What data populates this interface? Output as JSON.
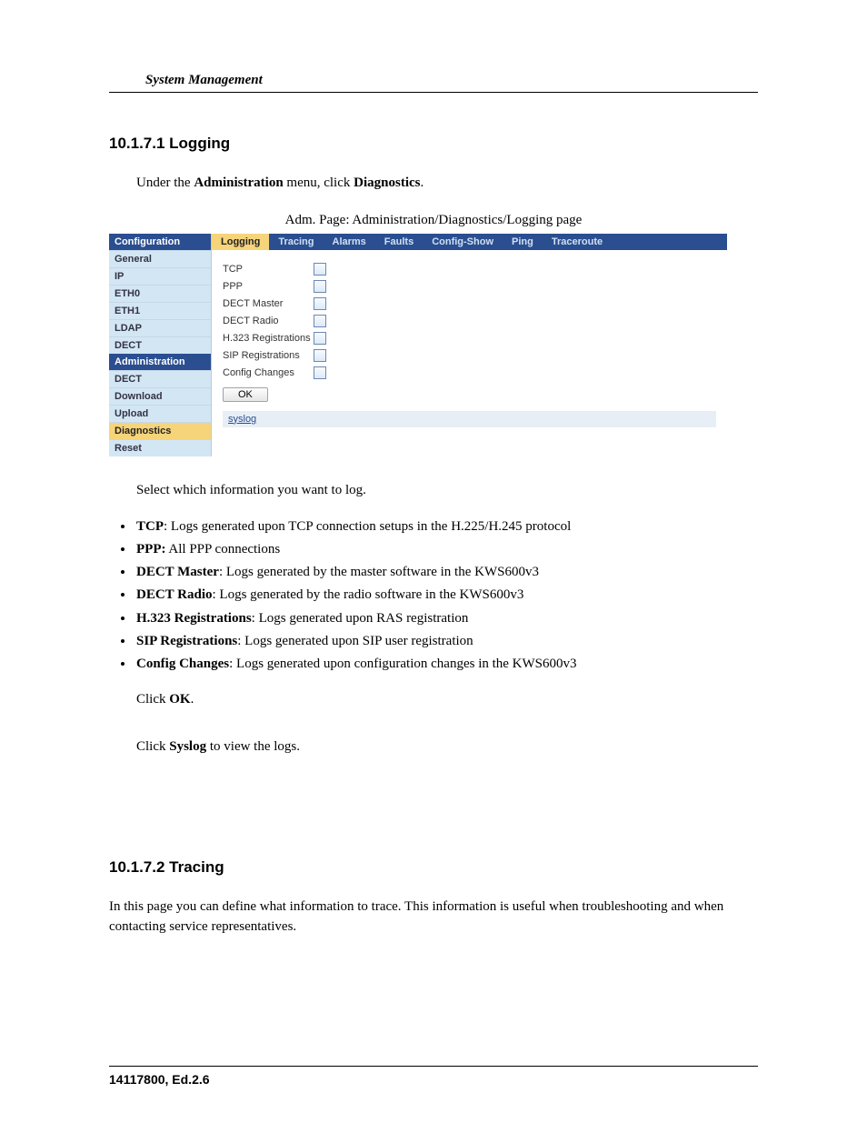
{
  "header": {
    "running": "System Management"
  },
  "sec1": {
    "number": "10.1.7.1  Logging",
    "intro_pre": "Under the ",
    "intro_b1": "Administration",
    "intro_mid": " menu, click ",
    "intro_b2": "Diagnostics",
    "intro_end": ".",
    "caption": "Adm. Page: Administration/Diagnostics/Logging page",
    "select_line": "Select which information you want to log.",
    "bullets": [
      {
        "b": "TCP",
        "rest": ": Logs generated upon TCP connection setups in the H.225/H.245 protocol"
      },
      {
        "b": "PPP:",
        "rest": " All PPP connections"
      },
      {
        "b": "DECT Master",
        "rest": ": Logs generated by the master software in the KWS600v3"
      },
      {
        "b": "DECT Radio",
        "rest": ": Logs generated by the radio software in the KWS600v3"
      },
      {
        "b": "H.323 Registrations",
        "rest": ": Logs generated upon RAS registration"
      },
      {
        "b": "SIP Registrations",
        "rest": ": Logs generated upon SIP user registration"
      },
      {
        "b": "Config Changes",
        "rest": ": Logs generated upon configuration changes in the KWS600v3"
      }
    ],
    "click_ok_pre": "Click ",
    "click_ok_b": "OK",
    "click_ok_end": ".",
    "click_syslog_pre": "Click ",
    "click_syslog_b": "Syslog",
    "click_syslog_end": " to view the logs."
  },
  "sec2": {
    "number": "10.1.7.2  Tracing",
    "para": "In this page you can define what information to trace. This information is useful when troubleshooting and when contacting service representatives."
  },
  "shot": {
    "sidebar": {
      "head1": "Configuration",
      "cfg": [
        "General",
        "IP",
        "ETH0",
        "ETH1",
        "LDAP",
        "DECT"
      ],
      "head2": "Administration",
      "adm": [
        "DECT",
        "Download",
        "Upload",
        "Diagnostics",
        "Reset"
      ],
      "selected": "Diagnostics"
    },
    "tabs": [
      "Logging",
      "Tracing",
      "Alarms",
      "Faults",
      "Config-Show",
      "Ping",
      "Traceroute"
    ],
    "tab_selected": "Logging",
    "options": [
      "TCP",
      "PPP",
      "DECT Master",
      "DECT Radio",
      "H.323 Registrations",
      "SIP Registrations",
      "Config Changes"
    ],
    "ok": "OK",
    "syslog": "syslog"
  },
  "footer": {
    "text": "14117800, Ed.2.6"
  }
}
